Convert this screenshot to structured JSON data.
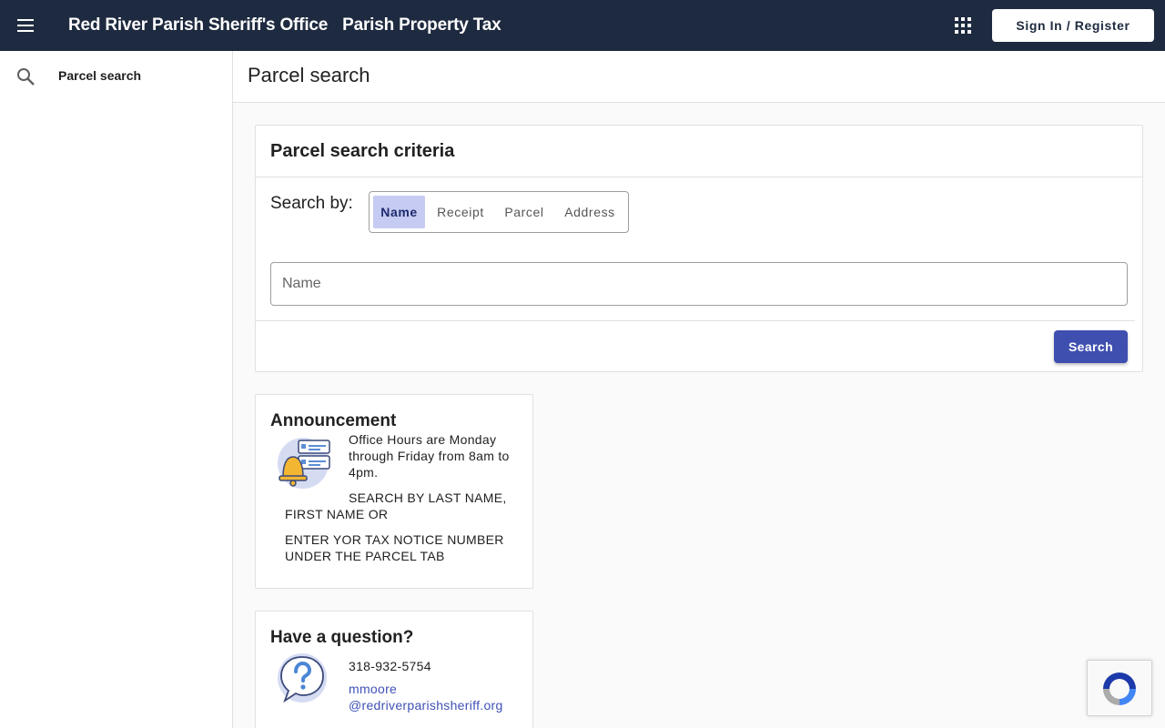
{
  "header": {
    "org_name": "Red River Parish Sheriff's Office",
    "app_name": "Parish Property Tax",
    "menu_icon": "menu-icon",
    "apps_icon": "apps-grid-icon",
    "signin_label": "Sign In / Register"
  },
  "sidebar": {
    "items": [
      {
        "icon": "search-icon",
        "label": "Parcel search"
      }
    ]
  },
  "page": {
    "title": "Parcel search"
  },
  "criteria": {
    "title": "Parcel search criteria",
    "search_by_label": "Search by:",
    "options": [
      "Name",
      "Receipt",
      "Parcel",
      "Address"
    ],
    "selected": "Name",
    "input_placeholder": "Name",
    "input_value": "",
    "search_label": "Search"
  },
  "announcement": {
    "title": "Announcement",
    "icon": "bell-notification-icon",
    "paragraphs": [
      "Office Hours are Monday through Friday from 8am to 4pm.",
      "SEARCH BY LAST NAME, FIRST NAME OR",
      "ENTER YOR TAX NOTICE NUMBER UNDER THE PARCEL TAB"
    ]
  },
  "question": {
    "title": "Have a question?",
    "icon": "question-bubble-icon",
    "phone": "318-932-5754",
    "email": "mmoore@redriverparishsheriff.org",
    "email_line1": "mmoore",
    "email_line2": "@redriverparishsheriff.org"
  },
  "colors": {
    "topbar": "#1e2a3f",
    "primary": "#3f4fb0",
    "selected_toggle": "#c5cbf2",
    "link": "#3f51b5"
  }
}
